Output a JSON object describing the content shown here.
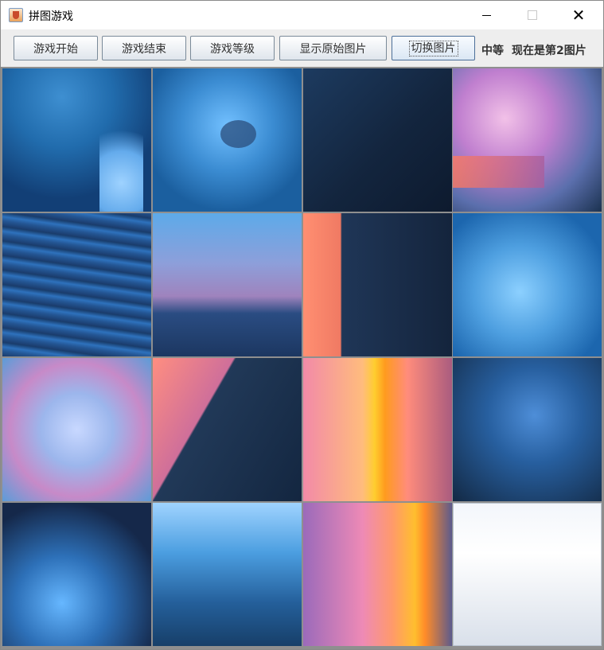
{
  "window": {
    "title": "拼图游戏",
    "controls": {
      "minimize": "—",
      "maximize": "",
      "close": "✕"
    }
  },
  "toolbar": {
    "buttons": [
      {
        "label": "游戏开始"
      },
      {
        "label": "游戏结束"
      },
      {
        "label": "游戏等级"
      },
      {
        "label": "显示原始图片"
      },
      {
        "label": "切换图片"
      }
    ],
    "level_text": "中等",
    "current_image_text": "现在是第2图片"
  },
  "puzzle": {
    "rows": 4,
    "columns": 4,
    "empty_tile": "bottom-right",
    "tile_count": 16
  },
  "colors": {
    "window_bg": "#eeeeee",
    "tile_border": "#8f8f8f",
    "accent_button_border": "#4c6f99"
  },
  "icons": {
    "app": "java-app-icon",
    "minimize": "minimize-icon",
    "maximize": "maximize-icon",
    "close": "close-icon"
  }
}
